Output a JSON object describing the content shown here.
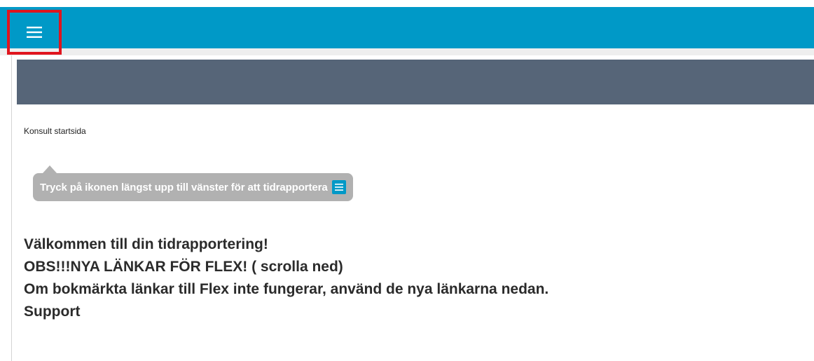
{
  "header": {
    "menu_icon": "hamburger-menu-icon",
    "accent_color": "#0099c7",
    "highlight_color": "#e0151e",
    "band_color": "#566578"
  },
  "main": {
    "page_label": "Konsult startsida",
    "tooltip": {
      "text": "Tryck på ikonen längst upp till vänster för att tidrapportera",
      "icon": "hamburger-menu-icon"
    },
    "welcome_lines": [
      "Välkommen till din tidrapportering!",
      "OBS!!!NYA LÄNKAR FÖR FLEX! ( scrolla ned)",
      "Om bokmärkta länkar till Flex inte fungerar, använd de nya länkarna nedan.",
      "Support"
    ]
  }
}
